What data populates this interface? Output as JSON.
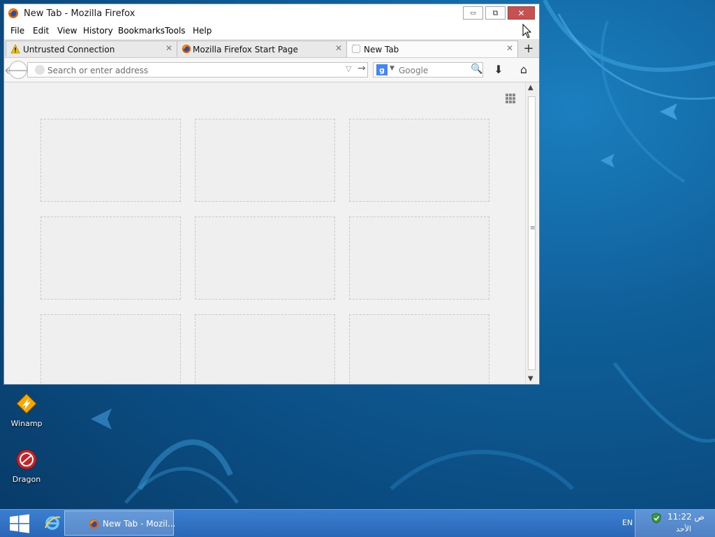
{
  "window": {
    "title": "New Tab - Mozilla Firefox",
    "controls": {
      "minimize": "▭",
      "restore": "⧉",
      "close": "✕"
    }
  },
  "menubar": {
    "items": [
      "File",
      "Edit",
      "View",
      "History",
      "Bookmarks",
      "Tools",
      "Help"
    ]
  },
  "tabs": [
    {
      "label": "Untrusted Connection",
      "icon": "warning-icon",
      "close": "✕"
    },
    {
      "label": "Mozilla Firefox Start Page",
      "icon": "firefox-icon",
      "close": "✕"
    },
    {
      "label": "New Tab",
      "icon": "blank-page-icon",
      "close": "✕",
      "active": true
    }
  ],
  "newtab": {
    "symbol": "+"
  },
  "navbar": {
    "back_symbol": "🡐",
    "url_placeholder": "Search or enter address",
    "url_dropdown": "▽",
    "url_go": "→",
    "search_engine_letter": "g",
    "search_engine_caret": "▼",
    "search_placeholder": "Google",
    "search_go": "🔍",
    "download_symbol": "⬇",
    "home_symbol": "⌂"
  },
  "scrollbar": {
    "up": "▲",
    "down": "▼",
    "grip": "≡"
  },
  "desktop_icons": [
    {
      "label": "Winamp",
      "icon": "winamp-icon"
    },
    {
      "label": "Dragon",
      "icon": "dragon-icon"
    }
  ],
  "taskbar": {
    "task_label": "New Tab - Mozil...",
    "language": "EN",
    "clock_time": "11:22 ص",
    "clock_day": "الأحد"
  },
  "colors": {
    "close_button": "#c75050",
    "taskbar": "#2a66b8",
    "desktop": "#0f5f99"
  }
}
